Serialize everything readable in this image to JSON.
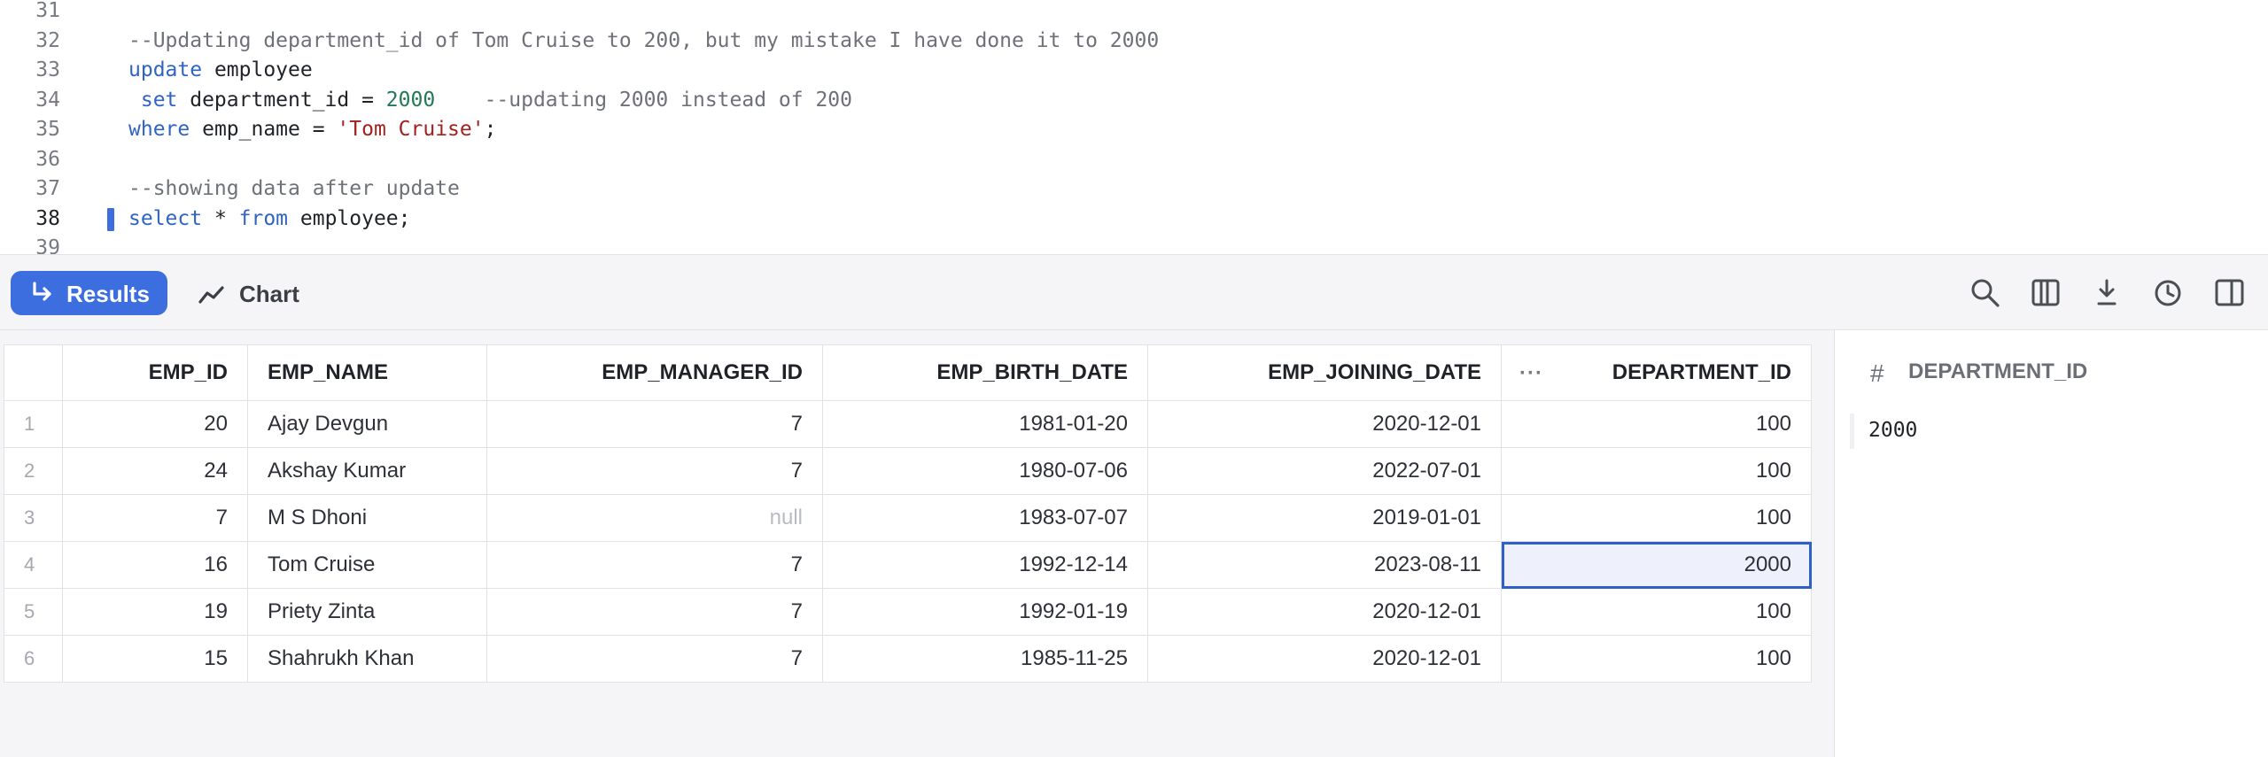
{
  "editor": {
    "lines": [
      {
        "num": "31",
        "active": false,
        "tokens": []
      },
      {
        "num": "32",
        "active": false,
        "tokens": [
          {
            "t": "--Updating department_id of Tom Cruise to 200, but my mistake I have done it to 2000",
            "c": "comment"
          }
        ]
      },
      {
        "num": "33",
        "active": false,
        "tokens": [
          {
            "t": "update",
            "c": "kw"
          },
          {
            "t": " employee",
            "c": "plain"
          }
        ]
      },
      {
        "num": "34",
        "active": false,
        "tokens": [
          {
            "t": " set",
            "c": "kw"
          },
          {
            "t": " department_id = ",
            "c": "plain"
          },
          {
            "t": "2000",
            "c": "num"
          },
          {
            "t": "    --updating 2000 instead of 200",
            "c": "comment"
          }
        ]
      },
      {
        "num": "35",
        "active": false,
        "tokens": [
          {
            "t": "where",
            "c": "kw"
          },
          {
            "t": " emp_name = ",
            "c": "plain"
          },
          {
            "t": "'Tom Cruise'",
            "c": "str"
          },
          {
            "t": ";",
            "c": "plain"
          }
        ]
      },
      {
        "num": "36",
        "active": false,
        "tokens": []
      },
      {
        "num": "37",
        "active": false,
        "tokens": [
          {
            "t": "--showing data after update",
            "c": "comment"
          }
        ]
      },
      {
        "num": "38",
        "active": true,
        "tokens": [
          {
            "t": "select",
            "c": "kw"
          },
          {
            "t": " * ",
            "c": "plain"
          },
          {
            "t": "from",
            "c": "kw"
          },
          {
            "t": " employee;",
            "c": "plain"
          }
        ]
      },
      {
        "num": "39",
        "active": false,
        "tokens": []
      }
    ]
  },
  "toolbar": {
    "results_label": "Results",
    "chart_label": "Chart",
    "icons": [
      "search-icon",
      "columns-icon",
      "download-icon",
      "history-icon",
      "side-panel-icon"
    ]
  },
  "grid": {
    "columns": [
      "",
      "EMP_ID",
      "EMP_NAME",
      "EMP_MANAGER_ID",
      "EMP_BIRTH_DATE",
      "EMP_JOINING_DATE",
      "DEPARTMENT_ID"
    ],
    "column_menu": "···",
    "rows": [
      [
        "1",
        "20",
        "Ajay Devgun",
        "7",
        "1981-01-20",
        "2020-12-01",
        "100"
      ],
      [
        "2",
        "24",
        "Akshay Kumar",
        "7",
        "1980-07-06",
        "2022-07-01",
        "100"
      ],
      [
        "3",
        "7",
        "M S Dhoni",
        "null",
        "1983-07-07",
        "2019-01-01",
        "100"
      ],
      [
        "4",
        "16",
        "Tom Cruise",
        "7",
        "1992-12-14",
        "2023-08-11",
        "2000"
      ],
      [
        "5",
        "19",
        "Priety Zinta",
        "7",
        "1992-01-19",
        "2020-12-01",
        "100"
      ],
      [
        "6",
        "15",
        "Shahrukh Khan",
        "7",
        "1985-11-25",
        "2020-12-01",
        "100"
      ]
    ],
    "selected_cell": {
      "row": 4,
      "column": "DEPARTMENT_ID"
    }
  },
  "side_panel": {
    "type_icon": "#",
    "title": "DEPARTMENT_ID",
    "value": "2000"
  },
  "colors": {
    "accent": "#3d6ee0",
    "keyword": "#2f64c5",
    "comment": "#6e7178",
    "number": "#1f7a55",
    "string": "#a3211e"
  }
}
